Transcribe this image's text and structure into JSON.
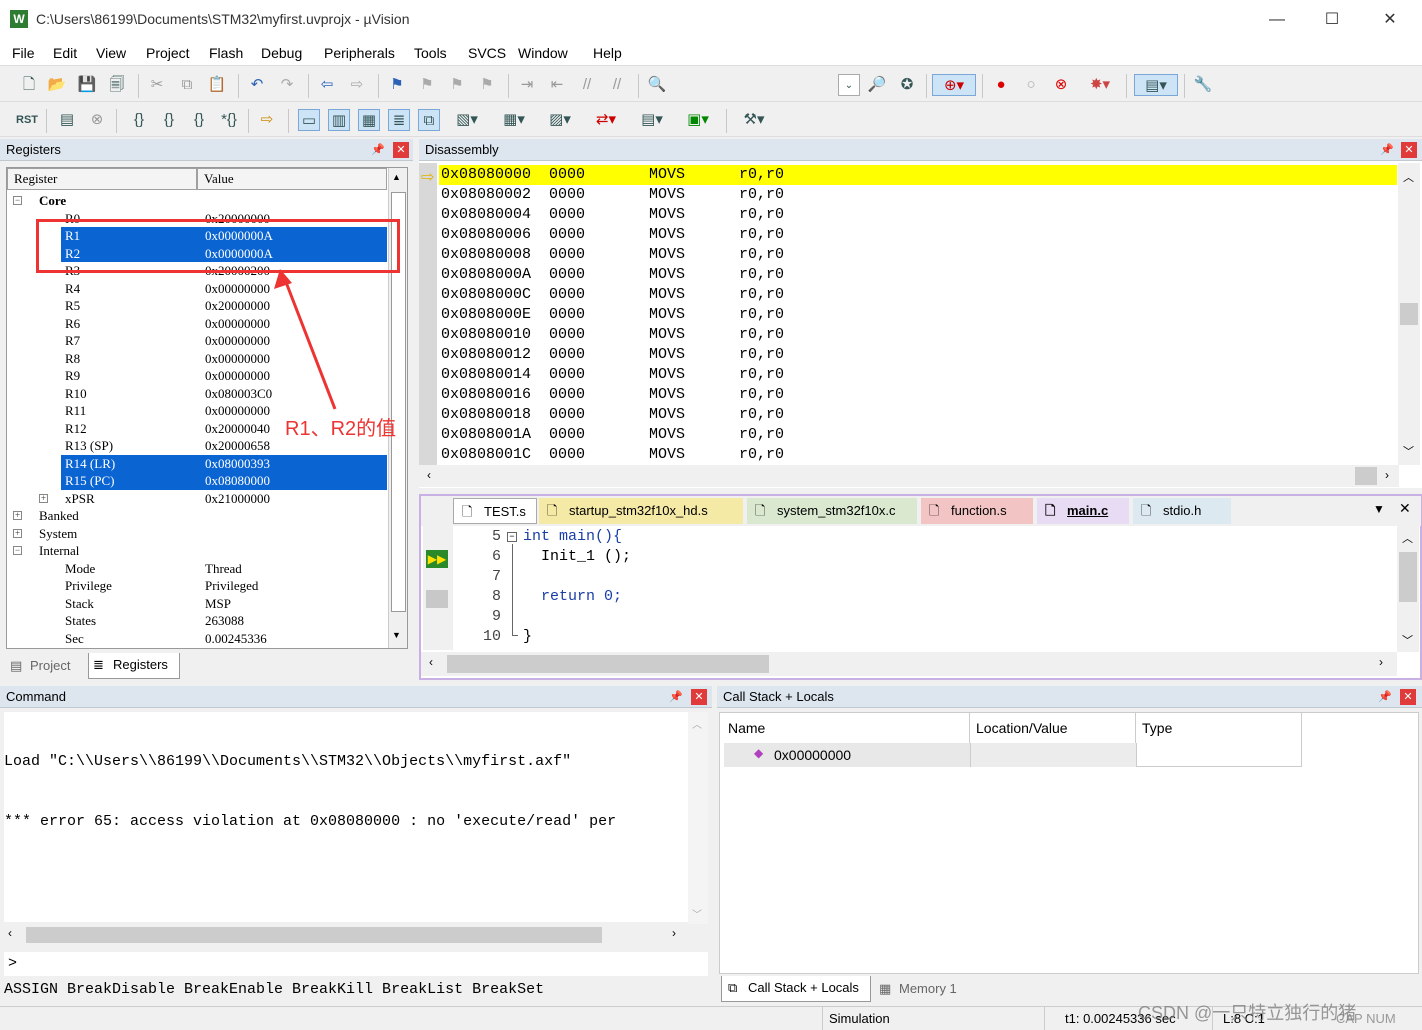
{
  "window": {
    "title": "C:\\Users\\86199\\Documents\\STM32\\myfirst.uvprojx - µVision",
    "app_icon": "W",
    "buttons": {
      "minimize": "—",
      "maximize": "☐",
      "close": "✕"
    }
  },
  "menu": [
    "File",
    "Edit",
    "View",
    "Project",
    "Flash",
    "Debug",
    "Peripherals",
    "Tools",
    "SVCS",
    "Window",
    "Help"
  ],
  "registers": {
    "title": "Registers",
    "col_register": "Register",
    "col_value": "Value",
    "core_label": "Core",
    "rows": [
      {
        "name": "R0",
        "value": "0x20000000",
        "selected": false
      },
      {
        "name": "R1",
        "value": "0x0000000A",
        "selected": true
      },
      {
        "name": "R2",
        "value": "0x0000000A",
        "selected": true
      },
      {
        "name": "R3",
        "value": "0x20000200",
        "selected": false
      },
      {
        "name": "R4",
        "value": "0x00000000",
        "selected": false
      },
      {
        "name": "R5",
        "value": "0x20000000",
        "selected": false
      },
      {
        "name": "R6",
        "value": "0x00000000",
        "selected": false
      },
      {
        "name": "R7",
        "value": "0x00000000",
        "selected": false
      },
      {
        "name": "R8",
        "value": "0x00000000",
        "selected": false
      },
      {
        "name": "R9",
        "value": "0x00000000",
        "selected": false
      },
      {
        "name": "R10",
        "value": "0x080003C0",
        "selected": false
      },
      {
        "name": "R11",
        "value": "0x00000000",
        "selected": false
      },
      {
        "name": "R12",
        "value": "0x20000040",
        "selected": false
      },
      {
        "name": "R13 (SP)",
        "value": "0x20000658",
        "selected": false
      },
      {
        "name": "R14 (LR)",
        "value": "0x08000393",
        "selected": true
      },
      {
        "name": "R15 (PC)",
        "value": "0x08080000",
        "selected": true
      }
    ],
    "xpsr": {
      "name": "xPSR",
      "value": "0x21000000"
    },
    "groups": [
      "Banked",
      "System",
      "Internal"
    ],
    "internal": [
      {
        "name": "Mode",
        "value": "Thread"
      },
      {
        "name": "Privilege",
        "value": "Privileged"
      },
      {
        "name": "Stack",
        "value": "MSP"
      },
      {
        "name": "States",
        "value": "263088"
      },
      {
        "name": "Sec",
        "value": "0.00245336"
      }
    ],
    "annotation": "R1、R2的值",
    "bottom_tabs": [
      "Project",
      "Registers"
    ]
  },
  "disassembly": {
    "title": "Disassembly",
    "rows": [
      {
        "addr": "0x08080000",
        "code": "0000",
        "op": "MOVS",
        "args": "r0,r0"
      },
      {
        "addr": "0x08080002",
        "code": "0000",
        "op": "MOVS",
        "args": "r0,r0"
      },
      {
        "addr": "0x08080004",
        "code": "0000",
        "op": "MOVS",
        "args": "r0,r0"
      },
      {
        "addr": "0x08080006",
        "code": "0000",
        "op": "MOVS",
        "args": "r0,r0"
      },
      {
        "addr": "0x08080008",
        "code": "0000",
        "op": "MOVS",
        "args": "r0,r0"
      },
      {
        "addr": "0x0808000A",
        "code": "0000",
        "op": "MOVS",
        "args": "r0,r0"
      },
      {
        "addr": "0x0808000C",
        "code": "0000",
        "op": "MOVS",
        "args": "r0,r0"
      },
      {
        "addr": "0x0808000E",
        "code": "0000",
        "op": "MOVS",
        "args": "r0,r0"
      },
      {
        "addr": "0x08080010",
        "code": "0000",
        "op": "MOVS",
        "args": "r0,r0"
      },
      {
        "addr": "0x08080012",
        "code": "0000",
        "op": "MOVS",
        "args": "r0,r0"
      },
      {
        "addr": "0x08080014",
        "code": "0000",
        "op": "MOVS",
        "args": "r0,r0"
      },
      {
        "addr": "0x08080016",
        "code": "0000",
        "op": "MOVS",
        "args": "r0,r0"
      },
      {
        "addr": "0x08080018",
        "code": "0000",
        "op": "MOVS",
        "args": "r0,r0"
      },
      {
        "addr": "0x0808001A",
        "code": "0000",
        "op": "MOVS",
        "args": "r0,r0"
      },
      {
        "addr": "0x0808001C",
        "code": "0000",
        "op": "MOVS",
        "args": "r0,r0"
      }
    ],
    "highlight_color": "#ffff00"
  },
  "editor": {
    "tabs": [
      {
        "label": "TEST.s",
        "color": "#ffffff"
      },
      {
        "label": "startup_stm32f10x_hd.s",
        "color": "#f5e9a6"
      },
      {
        "label": "system_stm32f10x.c",
        "color": "#d9e8cf"
      },
      {
        "label": "function.s",
        "color": "#f3c4c4"
      },
      {
        "label": "main.c",
        "color": "#e7dcf4"
      },
      {
        "label": "stdio.h",
        "color": "#dde9f0"
      }
    ],
    "lines": [
      {
        "no": "5",
        "text": "int main(){"
      },
      {
        "no": "6",
        "text": "  Init_1 ();"
      },
      {
        "no": "7",
        "text": ""
      },
      {
        "no": "8",
        "text": "  return 0;"
      },
      {
        "no": "9",
        "text": ""
      },
      {
        "no": "10",
        "text": "}"
      }
    ]
  },
  "command": {
    "title": "Command",
    "output": [
      "Load \"C:\\\\Users\\\\86199\\\\Documents\\\\STM32\\\\Objects\\\\myfirst.axf\"",
      "*** error 65: access violation at 0x08080000 : no 'execute/read' per"
    ],
    "prompt": ">",
    "hints": "ASSIGN BreakDisable BreakEnable BreakKill BreakList BreakSet"
  },
  "callstack": {
    "title": "Call Stack + Locals",
    "columns": [
      "Name",
      "Location/Value",
      "Type"
    ],
    "row": "0x00000000",
    "bottom_tabs": [
      "Call Stack + Locals",
      "Memory 1"
    ]
  },
  "status": {
    "mode": "Simulation",
    "time": "t1: 0.00245336 sec",
    "pos": "L:8 C:1",
    "caps": "CAP NUM",
    "watermark": "CSDN @一只特立独行的猪"
  }
}
